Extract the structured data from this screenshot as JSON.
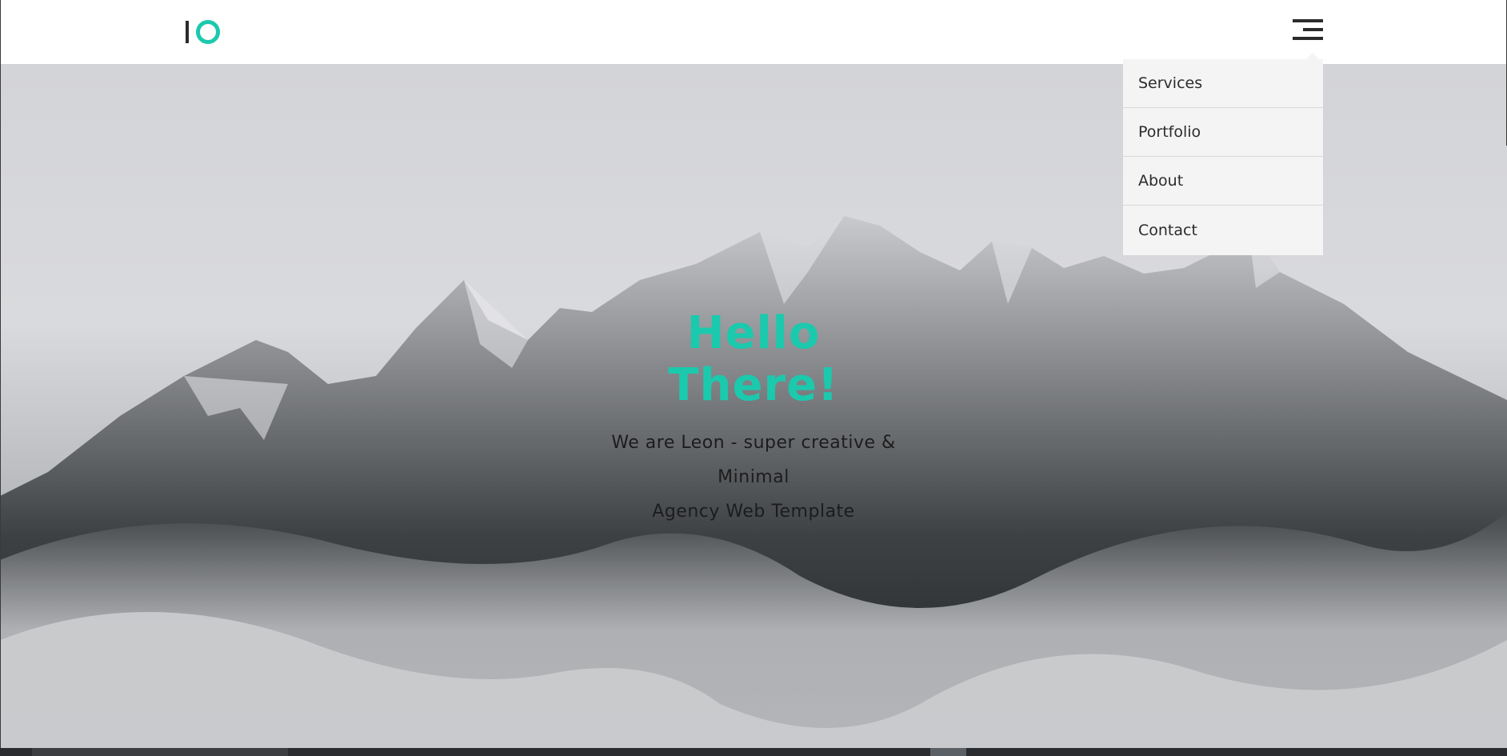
{
  "header": {
    "logo_text": "IO",
    "menu_icon": "hamburger-menu-icon"
  },
  "menu": {
    "items": [
      {
        "label": "Services"
      },
      {
        "label": "Portfolio"
      },
      {
        "label": "About"
      },
      {
        "label": "Contact"
      }
    ]
  },
  "hero": {
    "title": "Hello There!",
    "subtitle_line1": "We are Leon - super creative &",
    "subtitle_line2": "Minimal",
    "subtitle_line3": "Agency Web Template",
    "background": "misty-snowy-mountain-photo"
  },
  "colors": {
    "accent": "#1bc9ad",
    "text_dark": "#2b2b2b",
    "menu_bg": "#f4f4f4"
  }
}
